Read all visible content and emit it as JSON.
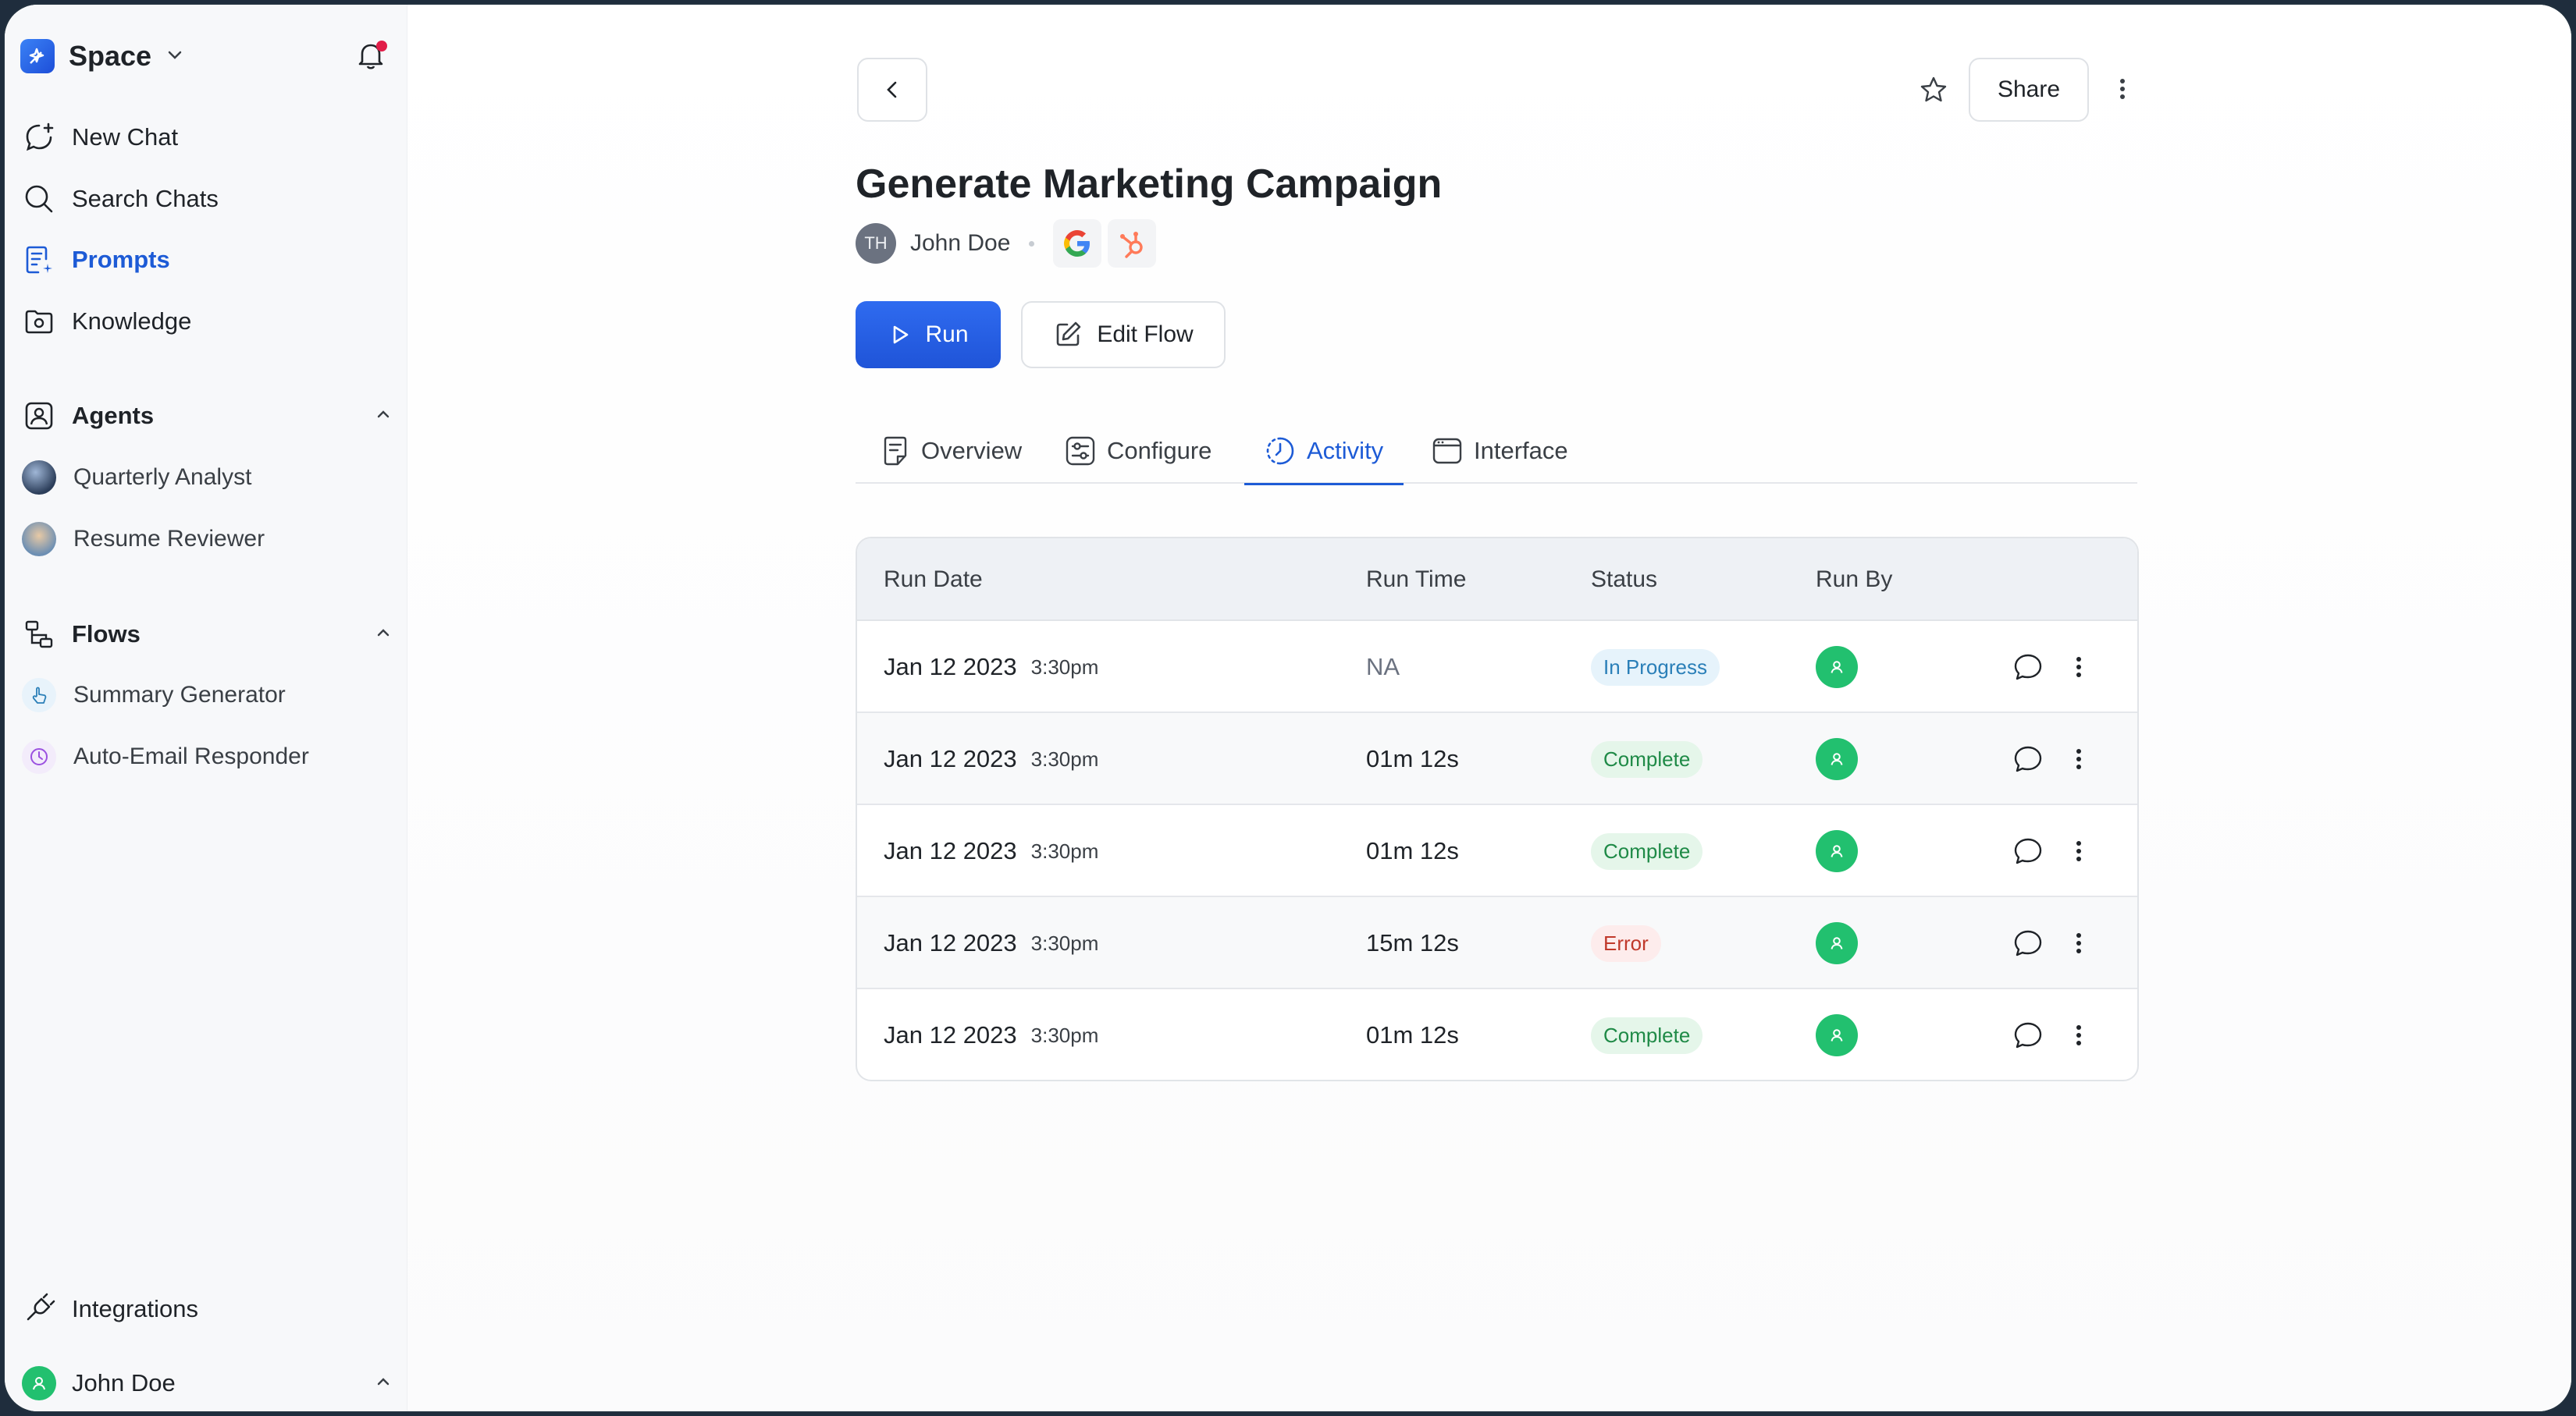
{
  "sidebar": {
    "brand": "Space",
    "nav": [
      {
        "label": "New Chat",
        "icon": "new-chat-icon"
      },
      {
        "label": "Search Chats",
        "icon": "search-icon"
      },
      {
        "label": "Prompts",
        "icon": "prompts-icon",
        "active": true
      },
      {
        "label": "Knowledge",
        "icon": "knowledge-icon"
      }
    ],
    "agents": {
      "title": "Agents",
      "items": [
        {
          "label": "Quarterly Analyst"
        },
        {
          "label": "Resume Reviewer"
        }
      ]
    },
    "flows": {
      "title": "Flows",
      "items": [
        {
          "label": "Summary Generator"
        },
        {
          "label": "Auto-Email Responder"
        }
      ]
    },
    "integrations": "Integrations",
    "user": "John Doe"
  },
  "header": {
    "share_label": "Share"
  },
  "page": {
    "title": "Generate Marketing Campaign",
    "author_initials": "TH",
    "author_name": "John Doe",
    "run_label": "Run",
    "edit_label": "Edit Flow"
  },
  "tabs": [
    {
      "label": "Overview"
    },
    {
      "label": "Configure"
    },
    {
      "label": "Activity",
      "active": true
    },
    {
      "label": "Interface"
    }
  ],
  "table": {
    "columns": [
      "Run Date",
      "Run Time",
      "Status",
      "Run By"
    ],
    "rows": [
      {
        "date": "Jan 12 2023",
        "time": "3:30pm",
        "run_time": "NA",
        "status": "In Progress"
      },
      {
        "date": "Jan 12 2023",
        "time": "3:30pm",
        "run_time": "01m 12s",
        "status": "Complete"
      },
      {
        "date": "Jan 12 2023",
        "time": "3:30pm",
        "run_time": "01m 12s",
        "status": "Complete"
      },
      {
        "date": "Jan 12 2023",
        "time": "3:30pm",
        "run_time": "15m 12s",
        "status": "Error"
      },
      {
        "date": "Jan 12 2023",
        "time": "3:30pm",
        "run_time": "01m 12s",
        "status": "Complete"
      }
    ]
  },
  "colors": {
    "accent": "#1d5bd6",
    "run_by": "#22c06f",
    "status_progress": "#2a7fb8",
    "status_complete": "#1f8a47",
    "status_error": "#c0392b"
  }
}
